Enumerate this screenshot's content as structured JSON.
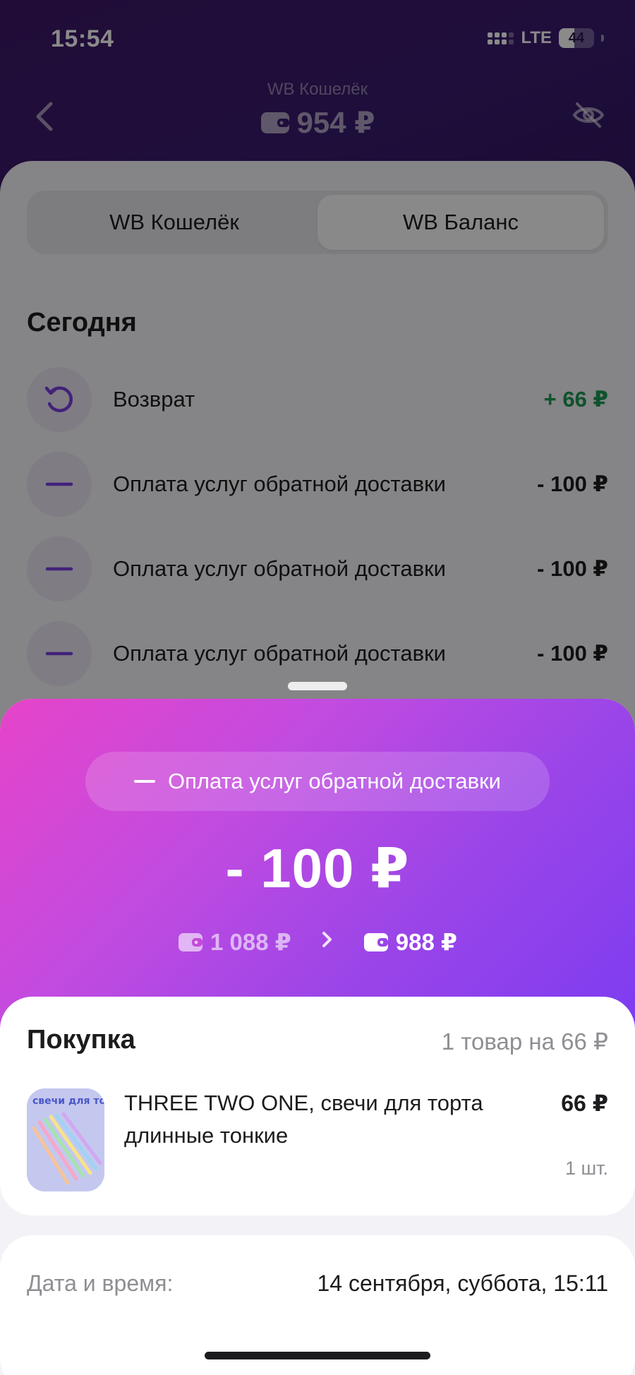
{
  "status_bar": {
    "time": "15:54",
    "network": "LTE",
    "battery": "44"
  },
  "nav": {
    "title": "WB Кошелёк",
    "balance": "954 ₽",
    "icons": {
      "back": "chevron-left-icon",
      "visibility": "eye-off-icon"
    }
  },
  "tabs": [
    {
      "label": "WB Кошелёк",
      "active": false
    },
    {
      "label": "WB Баланс",
      "active": true
    }
  ],
  "history": {
    "section_title": "Сегодня",
    "items": [
      {
        "icon": "refund-icon",
        "label": "Возврат",
        "amount": "+ 66 ₽",
        "positive": true
      },
      {
        "icon": "minus-icon",
        "label": "Оплата услуг обратной доставки",
        "amount": "- 100 ₽",
        "positive": false
      },
      {
        "icon": "minus-icon",
        "label": "Оплата услуг обратной доставки",
        "amount": "- 100 ₽",
        "positive": false
      },
      {
        "icon": "minus-icon",
        "label": "Оплата услуг обратной доставки",
        "amount": "- 100 ₽",
        "positive": false
      }
    ]
  },
  "detail": {
    "operation": "Оплата услуг обратной доставки",
    "amount": "- 100 ₽",
    "balance_before": "1 088 ₽",
    "balance_after": "988 ₽",
    "purchase": {
      "title": "Покупка",
      "summary": "1 товар на 66 ₽",
      "product_name": "THREE TWO ONE, свечи для торта длинные тонкие",
      "price": "66 ₽",
      "quantity": "1 шт.",
      "image_text": "свечи для торта"
    },
    "date_label": "Дата и время:",
    "date_value": "14 сентября, суббота, 15:11"
  },
  "colors": {
    "positive": "#1a9a52",
    "accent": "#7a3ee0",
    "hero_start": "#e644c9",
    "hero_end": "#7d3cf0"
  }
}
